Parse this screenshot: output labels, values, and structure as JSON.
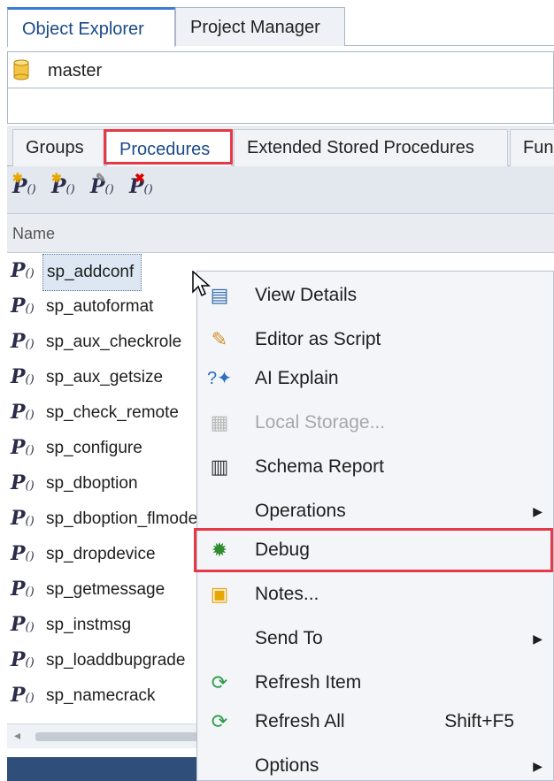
{
  "top_tabs": [
    {
      "label": "Object Explorer",
      "active": true
    },
    {
      "label": "Project Manager",
      "active": false
    }
  ],
  "database": {
    "name": "master",
    "icon": "database-icon"
  },
  "sub_tabs": [
    {
      "label": "Groups"
    },
    {
      "label": "Procedures",
      "active": true
    },
    {
      "label": "Extended Stored Procedures"
    },
    {
      "label": "Fun"
    }
  ],
  "toolbar": {
    "buttons": [
      {
        "icon": "new-procedure-icon"
      },
      {
        "icon": "new-procedure-wizard-icon"
      },
      {
        "icon": "edit-procedure-icon"
      },
      {
        "icon": "drop-procedure-icon"
      }
    ],
    "proc_glyph": "P",
    "paren_glyph": "()"
  },
  "list": {
    "column_header": "Name",
    "items": [
      "sp_addconf",
      "sp_autoformat",
      "sp_aux_checkrole",
      "sp_aux_getsize",
      "sp_check_remote",
      "sp_configure",
      "sp_dboption",
      "sp_dboption_flmode",
      "sp_dropdevice",
      "sp_getmessage",
      "sp_instmsg",
      "sp_loaddbupgrade",
      "sp_namecrack"
    ],
    "selected_index": 0
  },
  "context_menu": {
    "items": [
      {
        "label": "View Details",
        "icon": "view-details-icon"
      },
      {
        "label": "Editor as Script",
        "icon": "edit-script-icon"
      },
      {
        "label": "AI Explain",
        "icon": "ai-explain-icon"
      },
      {
        "label": "Local Storage...",
        "icon": "local-storage-icon",
        "disabled": true
      },
      {
        "label": "Schema Report",
        "icon": "schema-report-icon"
      },
      {
        "label": "Operations",
        "submenu": true
      },
      {
        "label": "Debug",
        "icon": "debug-icon",
        "highlighted": true
      },
      {
        "label": "Notes...",
        "icon": "notes-icon"
      },
      {
        "label": "Send To",
        "submenu": true
      },
      {
        "label": "Refresh Item",
        "icon": "refresh-item-icon"
      },
      {
        "label": "Refresh All",
        "icon": "refresh-all-icon",
        "shortcut": "Shift+F5"
      },
      {
        "label": "Options",
        "submenu": true
      }
    ]
  },
  "colors": {
    "highlight_red": "#e63946",
    "active_tab_accent": "#3a7bd5",
    "panel_bg": "#e9edf2"
  }
}
